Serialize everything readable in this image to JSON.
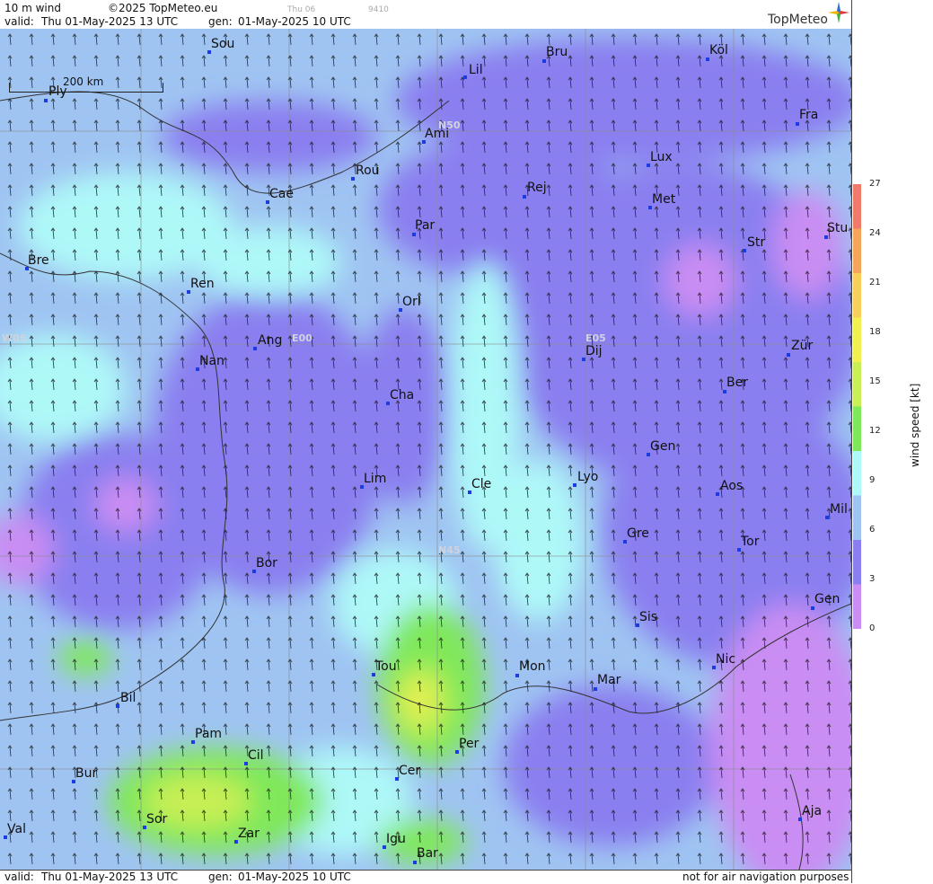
{
  "header": {
    "product": "10 m wind",
    "copyright": "©2025 TopMeteo.eu",
    "day": "Thu 06",
    "code": "9410",
    "valid_label": "valid:",
    "valid_time": "Thu  01-May-2025  13 UTC",
    "gen_label": "gen:",
    "gen_time": "01-May-2025 10 UTC",
    "logo": "TopMeteo"
  },
  "footer": {
    "valid_label": "valid:",
    "valid_time": "Thu  01-May-2025  13 UTC",
    "gen_label": "gen:",
    "gen_time": "01-May-2025 10 UTC",
    "disclaimer": "not for air navigation purposes"
  },
  "scale_bar": "200 km",
  "grid_labels": [
    "N50",
    "N45",
    "W05",
    "E00",
    "E05"
  ],
  "colorbar": {
    "title": "wind  speed  [kt]",
    "ticks": [
      "27",
      "24",
      "21",
      "18",
      "15",
      "12",
      "9",
      "6",
      "3",
      "0"
    ],
    "colors": [
      "#f07a6a",
      "#f5a65a",
      "#f7cf5a",
      "#f2f050",
      "#c8ef55",
      "#7fe85a",
      "#aef8f8",
      "#9fc4f2",
      "#8a7ff0",
      "#c98df3"
    ]
  },
  "cities": [
    "Sou",
    "Bru",
    "Köl",
    "Lil",
    "Ply",
    "Ami",
    "Fra",
    "Lux",
    "Rou",
    "Cae",
    "Rej",
    "Met",
    "Par",
    "Stu",
    "Str",
    "Bre",
    "Ren",
    "Orl",
    "Ang",
    "Dij",
    "Zür",
    "Nan",
    "Ber",
    "Cha",
    "Gen",
    "Lim",
    "Cle",
    "Lyo",
    "Aos",
    "Mil",
    "Gre",
    "Tor",
    "Bor",
    "Sis",
    "Gen",
    "Tou",
    "Mon",
    "Mar",
    "Nic",
    "Bil",
    "Pam",
    "Per",
    "Cil",
    "Bur",
    "Cer",
    "Ajа",
    "Sor",
    "Zar",
    "Val",
    "Igu",
    "Bar"
  ]
}
